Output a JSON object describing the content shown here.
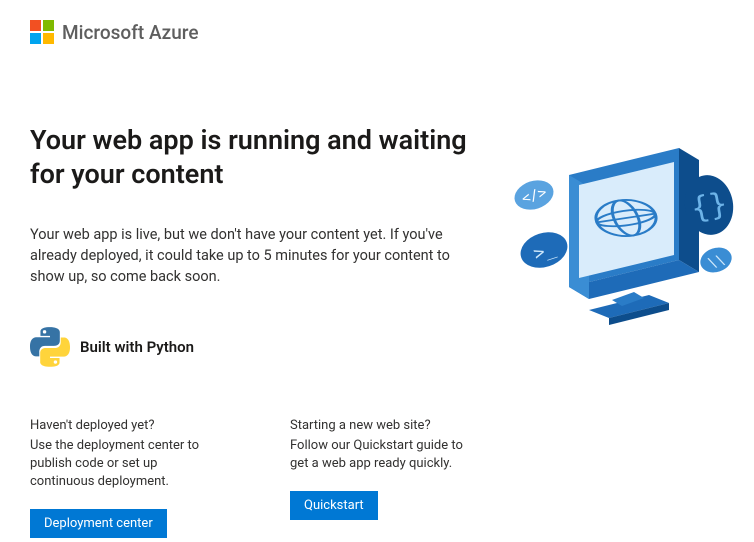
{
  "brand": "Microsoft Azure",
  "heading": "Your web app is running and waiting for your content",
  "description": "Your web app is live, but we don't have your content yet. If you've already deployed, it could take up to 5 minutes for your content to show up, so come back soon.",
  "built_with": "Built with Python",
  "columns": {
    "deploy": {
      "title": "Haven't deployed yet?",
      "body": "Use the deployment center to publish code or set up continuous deployment.",
      "button": "Deployment center"
    },
    "quickstart": {
      "title": "Starting a new web site?",
      "body": "Follow our Quickstart guide to get a web app ready quickly.",
      "button": "Quickstart"
    }
  },
  "colors": {
    "primary": "#0078d4"
  }
}
